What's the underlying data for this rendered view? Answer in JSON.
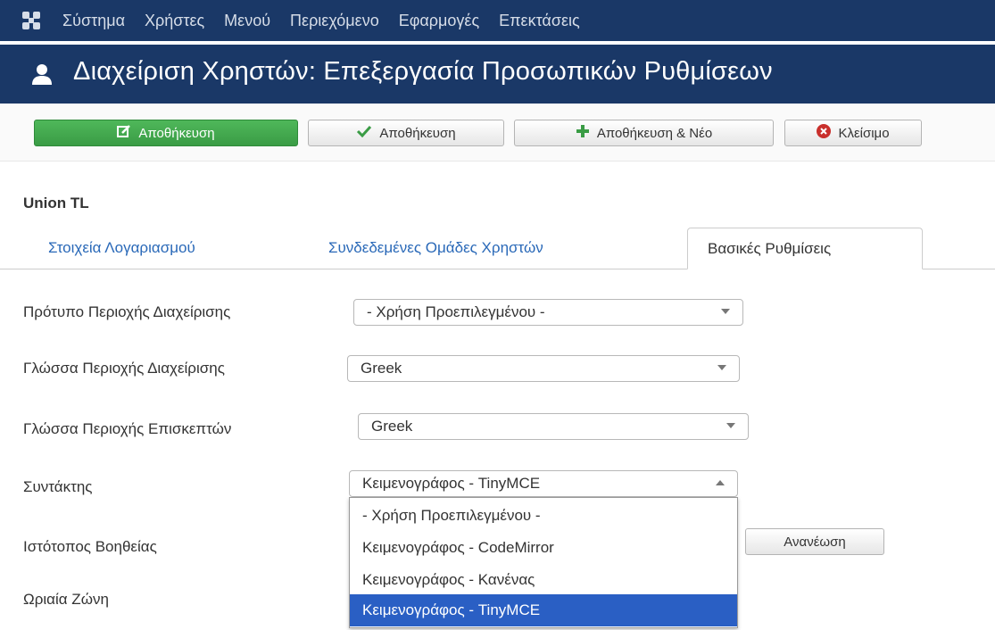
{
  "colors": {
    "nav_bg": "#1a3867",
    "accent_green": "#46a546",
    "selected_option": "#2a5fc4",
    "link": "#2a69b8"
  },
  "topnav": {
    "logo_icon": "joomla-icon",
    "items": [
      "Σύστημα",
      "Χρήστες",
      "Μενού",
      "Περιεχόμενο",
      "Εφαρμογές",
      "Επεκτάσεις"
    ]
  },
  "header": {
    "icon": "user-icon",
    "title": "Διαχείριση Χρηστών: Επεξεργασία Προσωπικών Ρυθμίσεων"
  },
  "toolbar": {
    "save_label": "Αποθήκευση",
    "save_close_label": "Αποθήκευση",
    "save_new_label": "Αποθήκευση & Νέο",
    "close_label": "Κλείσιμο"
  },
  "user": {
    "name": "Union TL"
  },
  "tabs": [
    {
      "label": "Στοιχεία Λογαριασμού",
      "active": false
    },
    {
      "label": "Συνδεδεμένες Ομάδες Χρηστών",
      "active": false
    },
    {
      "label": "Βασικές Ρυθμίσεις",
      "active": true
    }
  ],
  "form": {
    "admin_template": {
      "label": "Πρότυπο Περιοχής Διαχείρισης",
      "value": "- Χρήση Προεπιλεγμένου -"
    },
    "admin_language": {
      "label": "Γλώσσα Περιοχής Διαχείρισης",
      "value": "Greek"
    },
    "site_language": {
      "label": "Γλώσσα Περιοχής Επισκεπτών",
      "value": "Greek"
    },
    "editor": {
      "label": "Συντάκτης",
      "value": "Κειμενογράφος - TinyMCE",
      "options": [
        "- Χρήση Προεπιλεγμένου -",
        "Κειμενογράφος - CodeMirror",
        "Κειμενογράφος - Κανένας",
        "Κειμενογράφος - TinyMCE"
      ],
      "selected_index": 3
    },
    "help_site": {
      "label": "Ιστότοπος Βοηθείας",
      "refresh_label": "Ανανέωση"
    },
    "timezone": {
      "label": "Ωριαία Ζώνη"
    }
  }
}
